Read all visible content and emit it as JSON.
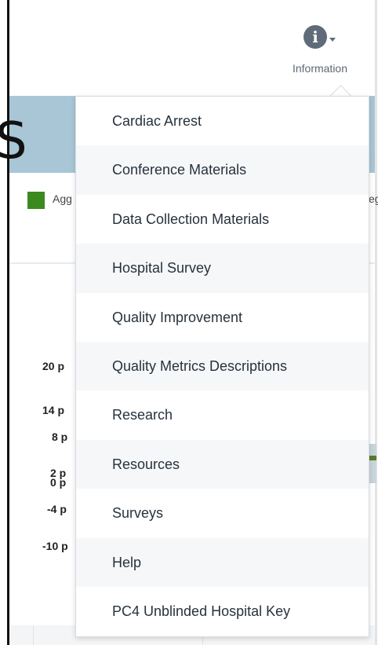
{
  "header": {
    "info_button_label": "Information",
    "info_icon": "info-circle-icon"
  },
  "background": {
    "big_letter": "S",
    "legend_left_text": "Agg",
    "legend_right_text": "eg",
    "legend_color": "#3a8a1f",
    "band_color": "#a8c6d6",
    "y_axis_labels": [
      "20 p",
      "14 p",
      "8 p",
      "2 p",
      "0 p",
      "-4 p",
      "-10 p"
    ]
  },
  "dropdown": {
    "items": [
      {
        "label": "Cardiac Arrest"
      },
      {
        "label": "Conference Materials"
      },
      {
        "label": "Data Collection Materials"
      },
      {
        "label": "Hospital Survey"
      },
      {
        "label": "Quality Improvement"
      },
      {
        "label": "Quality Metrics Descriptions"
      },
      {
        "label": "Research"
      },
      {
        "label": "Resources"
      },
      {
        "label": "Surveys"
      },
      {
        "label": "Help"
      },
      {
        "label": "PC4 Unblinded Hospital Key"
      }
    ]
  }
}
